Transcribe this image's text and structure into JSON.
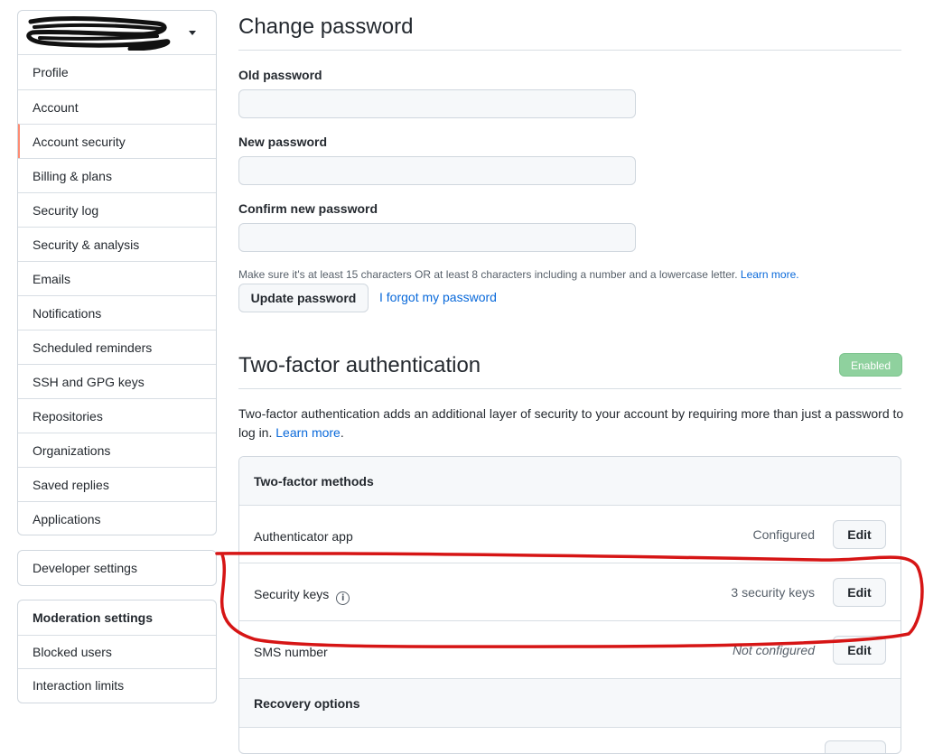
{
  "sidebar": {
    "context_name_redacted": true,
    "items": [
      {
        "label": "Profile"
      },
      {
        "label": "Account"
      },
      {
        "label": "Account security",
        "selected": true
      },
      {
        "label": "Billing & plans"
      },
      {
        "label": "Security log"
      },
      {
        "label": "Security & analysis"
      },
      {
        "label": "Emails"
      },
      {
        "label": "Notifications"
      },
      {
        "label": "Scheduled reminders"
      },
      {
        "label": "SSH and GPG keys"
      },
      {
        "label": "Repositories"
      },
      {
        "label": "Organizations"
      },
      {
        "label": "Saved replies"
      },
      {
        "label": "Applications"
      }
    ],
    "developer": {
      "label": "Developer settings"
    },
    "moderation": {
      "header": "Moderation settings",
      "items": [
        {
          "label": "Blocked users"
        },
        {
          "label": "Interaction limits"
        }
      ]
    }
  },
  "change_password": {
    "title": "Change password",
    "old_label": "Old password",
    "new_label": "New password",
    "confirm_label": "Confirm new password",
    "old_value": "",
    "new_value": "",
    "confirm_value": "",
    "hint": "Make sure it's at least 15 characters OR at least 8 characters including a number and a lowercase letter.",
    "hint_link": "Learn more.",
    "update_button": "Update password",
    "forgot_link": "I forgot my password"
  },
  "two_factor": {
    "title": "Two-factor authentication",
    "badge": "Enabled",
    "description": "Two-factor authentication adds an additional layer of security to your account by requiring more than just a password to log in.",
    "learn_more": "Learn more",
    "methods_header": "Two-factor methods",
    "methods": [
      {
        "name": "Authenticator app",
        "status": "Configured",
        "action": "Edit"
      },
      {
        "name": "Security keys",
        "status": "3 security keys",
        "action": "Edit",
        "info_icon": "info-icon"
      },
      {
        "name": "SMS number",
        "status": "Not configured",
        "action": "Edit"
      }
    ],
    "recovery_header": "Recovery options"
  },
  "colors": {
    "accent": "#0969da",
    "selected_indicator": "#fd8c73",
    "enabled_badge": "#8fd19e",
    "annotation_red": "#d61515"
  }
}
